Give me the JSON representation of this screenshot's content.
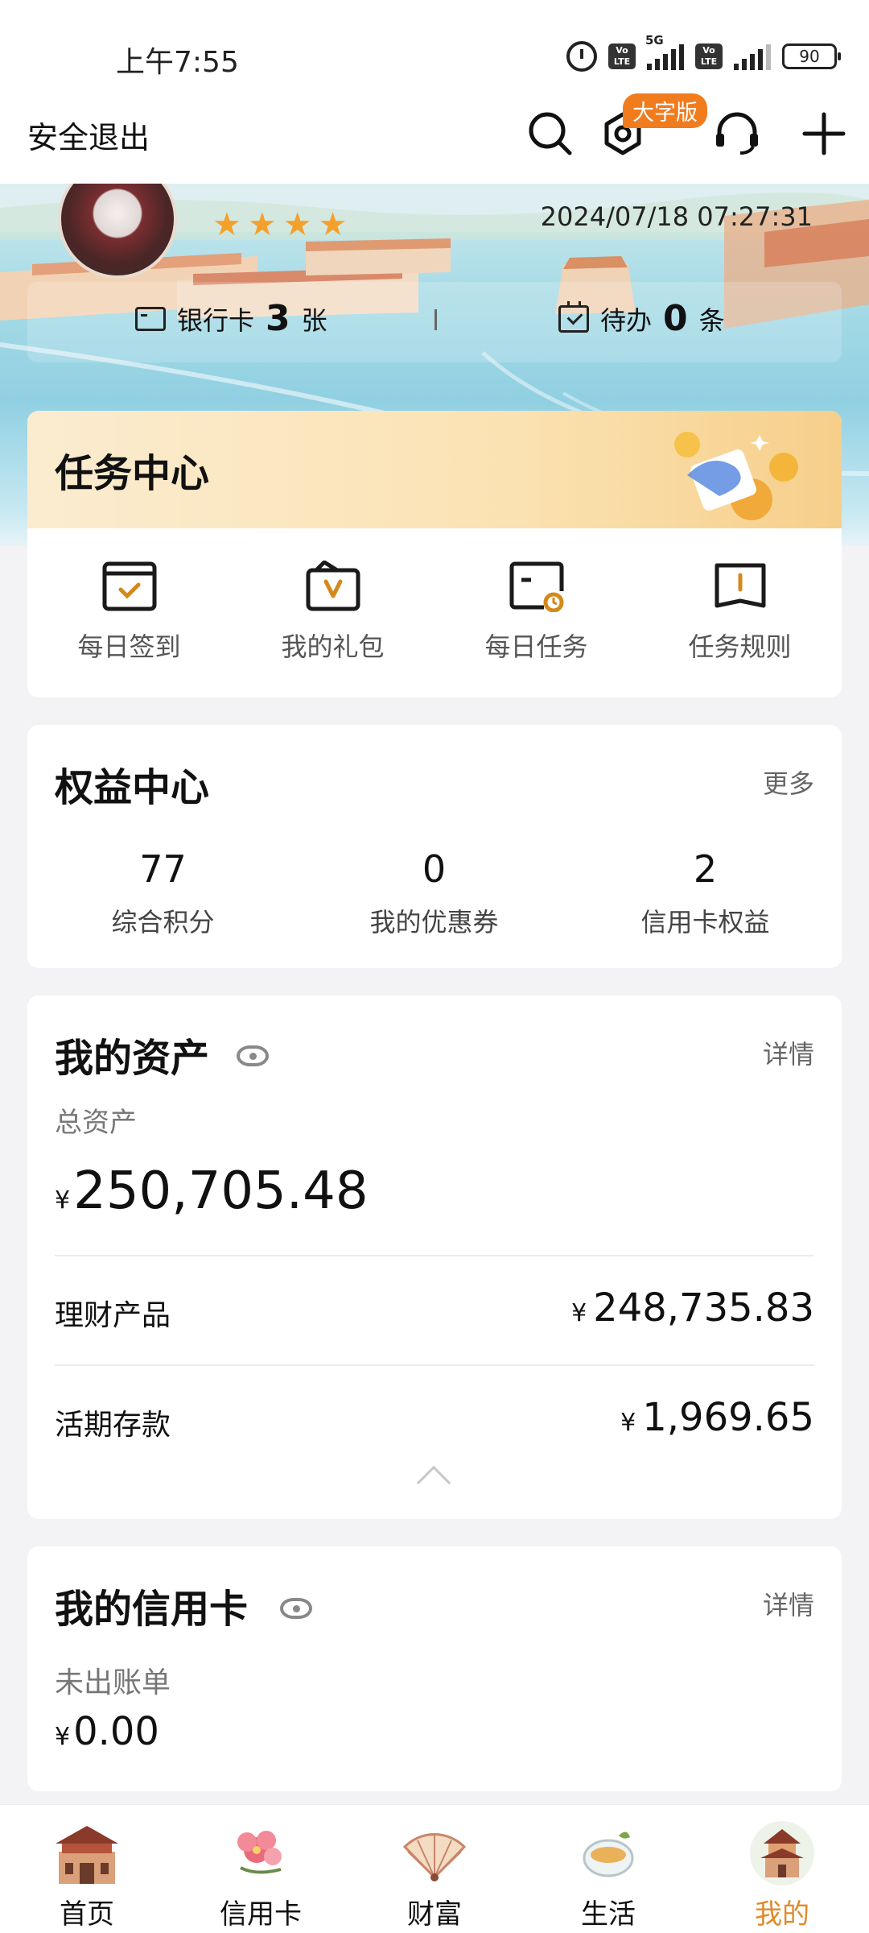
{
  "status_bar": {
    "time": "上午7:55",
    "network": "5G",
    "volte_label": "Vo LTE",
    "battery": "90"
  },
  "top_bar": {
    "logout_label": "安全退出",
    "large_font_badge": "大字版",
    "icons": [
      "search-icon",
      "settings-icon",
      "customer-service-icon",
      "plus-icon"
    ]
  },
  "banner": {
    "datetime": "2024/07/18 07:27:31",
    "star_count": 4,
    "bank_card": {
      "label": "银行卡",
      "count": "3",
      "unit": "张"
    },
    "todo": {
      "label": "待办",
      "count": "0",
      "unit": "条"
    }
  },
  "task_center": {
    "title": "任务中心",
    "items": [
      {
        "label": "每日签到",
        "icon": "daily-checkin-icon"
      },
      {
        "label": "我的礼包",
        "icon": "gift-pack-icon"
      },
      {
        "label": "每日任务",
        "icon": "daily-task-icon"
      },
      {
        "label": "任务规则",
        "icon": "task-rules-icon"
      }
    ]
  },
  "equity_center": {
    "title": "权益中心",
    "more_label": "更多",
    "items": [
      {
        "value": "77",
        "label": "综合积分"
      },
      {
        "value": "0",
        "label": "我的优惠券"
      },
      {
        "value": "2",
        "label": "信用卡权益"
      }
    ]
  },
  "assets": {
    "title": "我的资产",
    "detail_label": "详情",
    "total_label": "总资产",
    "currency": "¥",
    "total_value": "250,705.48",
    "rows": [
      {
        "label": "理财产品",
        "value": "248,735.83"
      },
      {
        "label": "活期存款",
        "value": "1,969.65"
      }
    ]
  },
  "credit_card": {
    "title": "我的信用卡",
    "detail_label": "详情",
    "unbilled_label": "未出账单",
    "currency": "¥",
    "unbilled_value": "0.00"
  },
  "bottom_nav": {
    "items": [
      {
        "label": "首页",
        "active": false
      },
      {
        "label": "信用卡",
        "active": false
      },
      {
        "label": "财富",
        "active": false
      },
      {
        "label": "生活",
        "active": false
      },
      {
        "label": "我的",
        "active": true
      }
    ],
    "active_color": "#e08a2a"
  },
  "colors": {
    "accent_orange": "#f07c1e",
    "star_color": "#f4a12c",
    "task_icon_accent": "#d4891c"
  }
}
